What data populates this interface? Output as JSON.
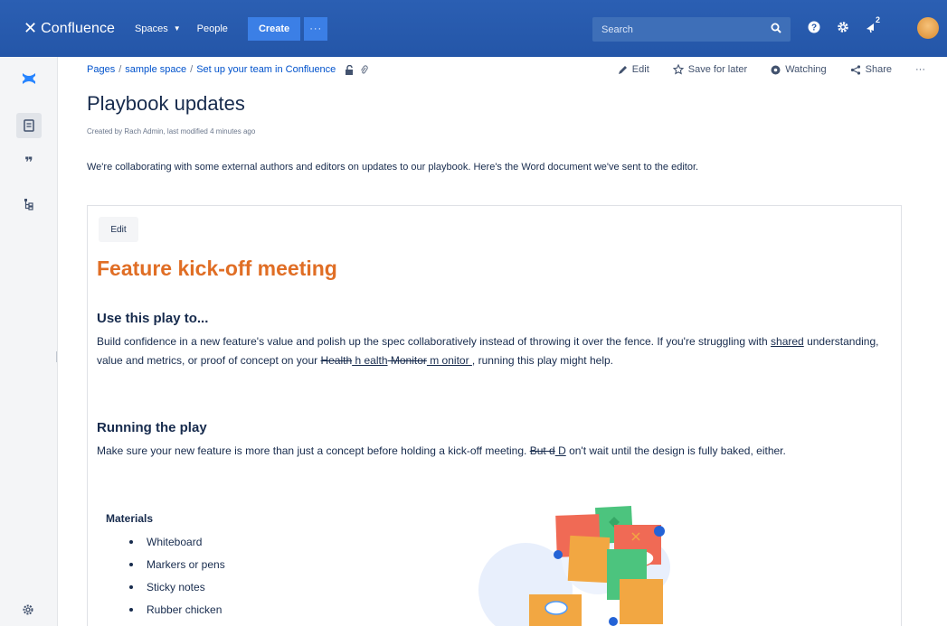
{
  "topnav": {
    "brand": "Confluence",
    "spaces_label": "Spaces",
    "people_label": "People",
    "create_label": "Create",
    "more_label": "···",
    "search_placeholder": "Search",
    "notification_count": "2"
  },
  "breadcrumb": {
    "items": [
      "Pages",
      "sample space",
      "Set up your team in Confluence"
    ]
  },
  "page_actions": {
    "edit": "Edit",
    "save_for_later": "Save for later",
    "watching": "Watching",
    "share": "Share",
    "more": "···"
  },
  "page": {
    "title": "Playbook updates",
    "byline": "Created by Rach Admin, last modified 4 minutes ago",
    "intro": "We're collaborating with some external authors and editors on updates to our playbook.  Here's the Word document we've sent to the editor."
  },
  "document": {
    "edit_label": "Edit",
    "heading": "Feature kick-off meeting",
    "section1_title": "Use this play to...",
    "section1_part1": "Build confidence in a new feature's value and polish up the spec collaboratively instead of throwing it over the fence. If you're struggling with ",
    "section1_shared": "shared",
    "section1_part2": " understanding, value and metrics, or proof of concept on your ",
    "section1_del1": "Health",
    "section1_ins1": " h ealth",
    "section1_del2": " Monitor",
    "section1_ins2": " m onitor ",
    "section1_part3": ", running this play might help.",
    "section2_title": "Running the play",
    "section2_part1": "Make sure your new feature is more than just a concept before holding a kick-off meeting. ",
    "section2_del": "But d",
    "section2_ins": " D",
    "section2_part2": " on't wait until the design is fully baked, either.",
    "materials_title": "Materials",
    "materials": [
      "Whiteboard",
      "Markers or pens",
      "Sticky notes",
      "Rubber chicken"
    ]
  },
  "colors": {
    "nav_bg": "#2456a8",
    "create_bg": "#3b7fe6",
    "heading_orange": "#e06e25",
    "link_blue": "#0052cc"
  }
}
